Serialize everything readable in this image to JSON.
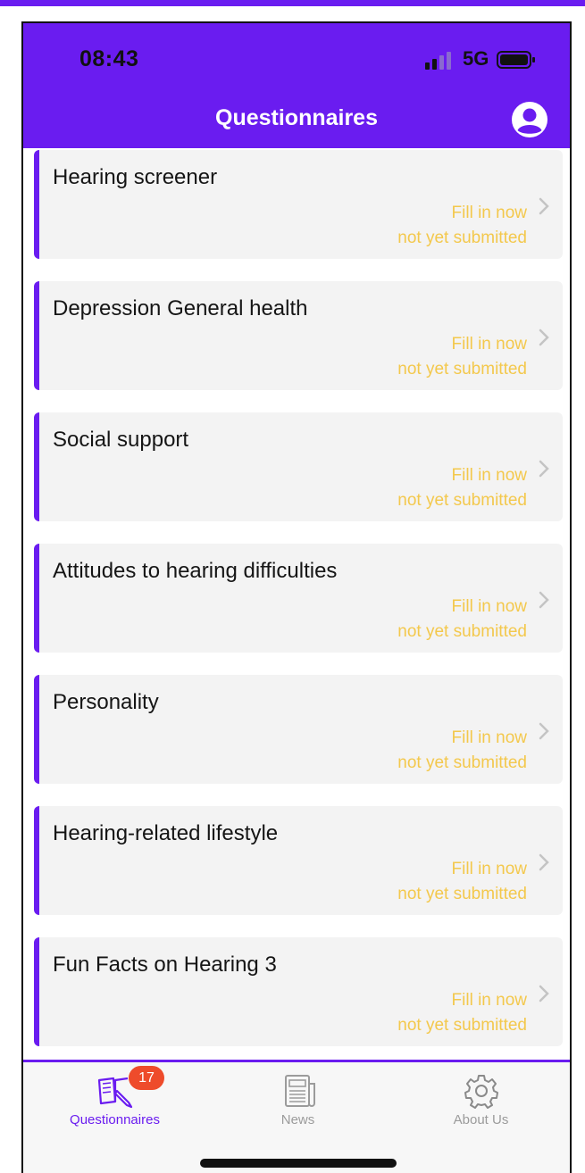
{
  "status_bar": {
    "time": "08:43",
    "network": "5G"
  },
  "header": {
    "title": "Questionnaires",
    "profile_icon": "person-circle-icon"
  },
  "questionnaires": [
    {
      "title": "Hearing screener",
      "action": "Fill in now",
      "status": "not yet submitted"
    },
    {
      "title": "Depression General health",
      "action": "Fill in now",
      "status": "not yet submitted"
    },
    {
      "title": "Social support",
      "action": "Fill in now",
      "status": "not yet submitted"
    },
    {
      "title": "Attitudes to hearing difficulties",
      "action": "Fill in now",
      "status": "not yet submitted"
    },
    {
      "title": "Personality",
      "action": "Fill in now",
      "status": "not yet submitted"
    },
    {
      "title": "Hearing-related lifestyle",
      "action": "Fill in now",
      "status": "not yet submitted"
    },
    {
      "title": "Fun Facts on Hearing 3",
      "action": "Fill in now",
      "status": "not yet submitted"
    }
  ],
  "tabbar": {
    "questionnaires": {
      "label": "Questionnaires",
      "badge": "17",
      "icon": "book-edit-icon"
    },
    "news": {
      "label": "News",
      "icon": "newspaper-icon"
    },
    "about": {
      "label": "About Us",
      "icon": "gear-icon"
    }
  },
  "colors": {
    "accent": "#6a1cf0",
    "status_text": "#f3c84c",
    "badge": "#ee4b2b",
    "card_bg": "#f3f3f3"
  }
}
